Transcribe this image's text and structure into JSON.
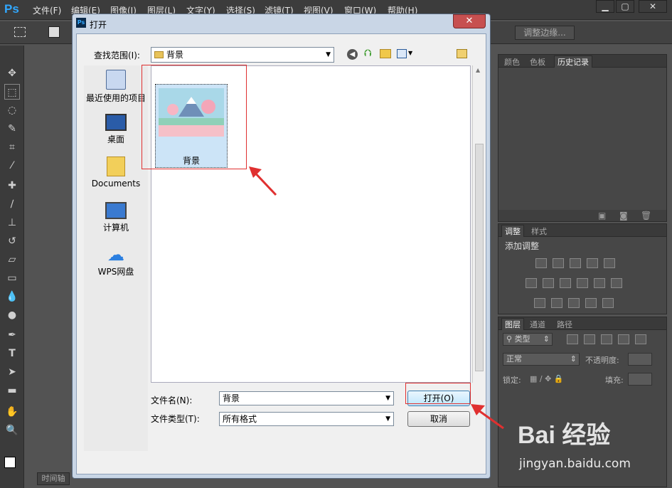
{
  "app": {
    "logo": "Ps",
    "menu": [
      "文件(F)",
      "编辑(E)",
      "图像(I)",
      "图层(L)",
      "文字(Y)",
      "选择(S)",
      "滤镜(T)",
      "视图(V)",
      "窗口(W)",
      "帮助(H)"
    ],
    "window_controls": [
      "▁",
      "▢",
      "✕"
    ]
  },
  "options_bar": {
    "refine_edge": "调整边缘..."
  },
  "timeline_tab": "时间轴",
  "panels": {
    "history_tabs": [
      "颜色",
      "色板",
      "历史记录"
    ],
    "adjust_tabs": [
      "调整",
      "样式"
    ],
    "adjust_title": "添加调整",
    "layers_tabs": [
      "图层",
      "通道",
      "路径"
    ],
    "layers_filter": "类型",
    "blend_mode": "正常",
    "opacity_label": "不透明度:",
    "lock_label": "锁定:",
    "fill_label": "填充:"
  },
  "dialog": {
    "title": "打开",
    "lookin_label": "查找范围(I):",
    "lookin_value": "背景",
    "places": [
      {
        "label": "最近使用的项目",
        "icon": "recent-items-icon"
      },
      {
        "label": "桌面",
        "icon": "desktop-icon"
      },
      {
        "label": "Documents",
        "icon": "documents-folder-icon"
      },
      {
        "label": "计算机",
        "icon": "computer-icon"
      },
      {
        "label": "WPS网盘",
        "icon": "wps-cloud-icon"
      }
    ],
    "file": {
      "name": "背景"
    },
    "filename_label": "文件名(N):",
    "filename_value": "背景",
    "filetype_label": "文件类型(T):",
    "filetype_value": "所有格式",
    "open_button": "打开(O)",
    "cancel_button": "取消"
  },
  "watermark": {
    "brand": "Bai 经验",
    "url": "jingyan.baidu.com"
  },
  "colors": {
    "highlight": "#e03030",
    "selection": "#cce4f7"
  }
}
